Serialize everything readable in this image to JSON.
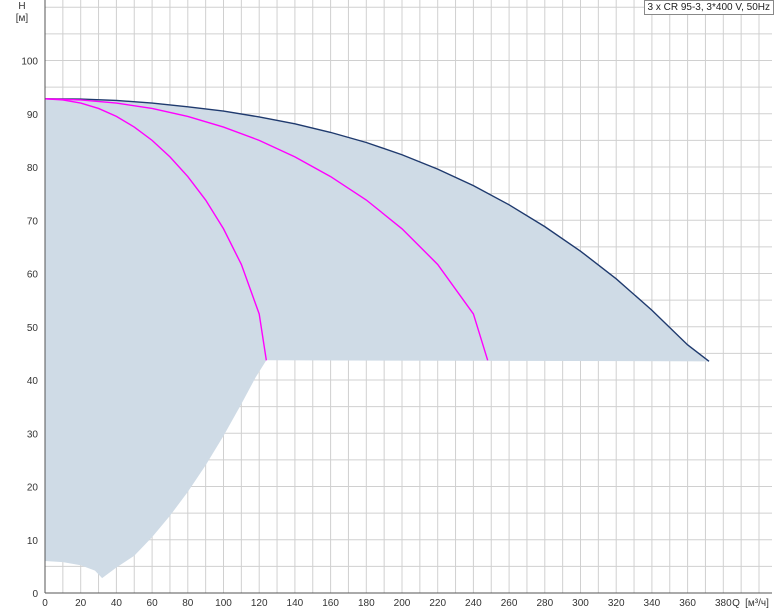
{
  "chart_data": {
    "type": "area",
    "title": "3 x CR 95-3, 3*400 V, 50Hz",
    "ylabel": "H",
    "yunit": "[м]",
    "xlabel": "Q",
    "xunit": "[м³/ч]",
    "xlim": [
      0,
      410
    ],
    "ylim": [
      0,
      110
    ],
    "xticks": [
      0,
      20,
      40,
      60,
      80,
      100,
      120,
      140,
      160,
      180,
      200,
      220,
      240,
      260,
      280,
      300,
      320,
      340,
      360,
      380
    ],
    "yticks": [
      0,
      10,
      20,
      30,
      40,
      50,
      60,
      70,
      80,
      90,
      100
    ],
    "grid": true,
    "colors": {
      "area": "#cfdbe6",
      "max_curve": "#1f3a6e",
      "pump_curves": "#ff00ff",
      "grid": "#d0d0d0"
    },
    "operating_area": {
      "min_flow_boundary": [
        [
          0,
          6
        ],
        [
          10,
          5.8
        ],
        [
          20,
          5.2
        ],
        [
          28,
          4.2
        ],
        [
          32,
          2.8
        ],
        [
          40,
          4.8
        ],
        [
          50,
          7
        ],
        [
          60,
          10.5
        ],
        [
          70,
          14.5
        ],
        [
          80,
          19
        ],
        [
          90,
          24
        ],
        [
          100,
          29.5
        ],
        [
          110,
          35.5
        ],
        [
          118,
          40.5
        ],
        [
          124,
          43.7
        ]
      ],
      "min_head": 43.7
    },
    "series": [
      {
        "curve": "max",
        "x": [
          0,
          20,
          40,
          60,
          80,
          100,
          120,
          140,
          160,
          180,
          200,
          220,
          240,
          260,
          280,
          300,
          320,
          340,
          360,
          372
        ],
        "y": [
          92.8,
          92.75,
          92.5,
          92.0,
          91.3,
          90.5,
          89.4,
          88.1,
          86.5,
          84.6,
          82.3,
          79.6,
          76.5,
          72.9,
          68.8,
          64.2,
          59.0,
          53.1,
          46.6,
          43.5
        ]
      },
      {
        "curve": "one-pump",
        "x": [
          0,
          10,
          20,
          30,
          40,
          50,
          60,
          70,
          80,
          90,
          100,
          110,
          120,
          124
        ],
        "y": [
          92.8,
          92.6,
          92.0,
          91.0,
          89.5,
          87.5,
          85.0,
          81.9,
          78.2,
          73.8,
          68.4,
          61.7,
          52.4,
          43.7
        ]
      },
      {
        "curve": "two-pumps",
        "x": [
          0,
          20,
          40,
          60,
          80,
          100,
          120,
          140,
          160,
          180,
          200,
          220,
          240,
          248
        ],
        "y": [
          92.8,
          92.6,
          92.0,
          91.0,
          89.5,
          87.5,
          85.0,
          81.9,
          78.2,
          73.8,
          68.4,
          61.7,
          52.4,
          43.7
        ]
      }
    ]
  }
}
